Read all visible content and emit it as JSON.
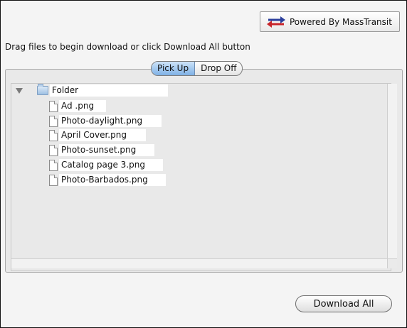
{
  "header": {
    "powered_label": "Powered By MassTransit",
    "icon": "transfer-arrows-icon",
    "icon_colors": {
      "blue": "#2a3e9c",
      "red": "#c8252a"
    }
  },
  "instructions": "Drag files to begin download or click Download All button",
  "tabs": [
    {
      "label": "Pick Up",
      "active": true
    },
    {
      "label": "Drop Off",
      "active": false
    }
  ],
  "tree": {
    "folder": {
      "label": "Folder",
      "icon": "folder-icon",
      "expanded": true
    },
    "files": [
      {
        "label": "Ad .png",
        "icon": "file-icon"
      },
      {
        "label": "Photo-daylight.png",
        "icon": "file-icon"
      },
      {
        "label": "April Cover.png",
        "icon": "file-icon"
      },
      {
        "label": "Photo-sunset.png",
        "icon": "file-icon"
      },
      {
        "label": "Catalog page 3.png",
        "icon": "file-icon"
      },
      {
        "label": "Photo-Barbados.png",
        "icon": "file-icon"
      }
    ]
  },
  "footer": {
    "download_all_label": "Download All"
  }
}
